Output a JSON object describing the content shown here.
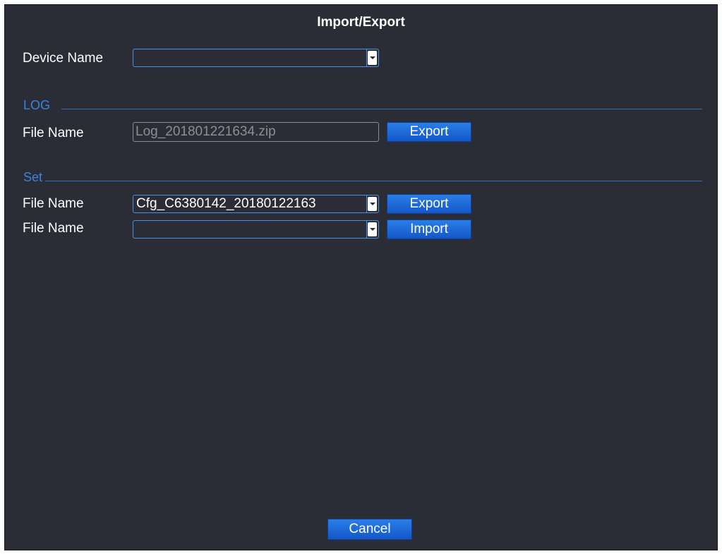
{
  "window": {
    "title": "Import/Export"
  },
  "device": {
    "label": "Device Name",
    "value": ""
  },
  "log_section": {
    "title": "LOG",
    "file_label": "File Name",
    "file_value": "Log_201801221634.zip",
    "export_label": "Export"
  },
  "set_section": {
    "title": "Set",
    "export_row": {
      "file_label": "File Name",
      "file_value": "Cfg_C6380142_20180122163",
      "button_label": "Export"
    },
    "import_row": {
      "file_label": "File Name",
      "file_value": "",
      "button_label": "Import"
    }
  },
  "footer": {
    "cancel_label": "Cancel"
  },
  "icons": {
    "dropdown": "chevron-down-icon"
  },
  "colors": {
    "background": "#2b2d36",
    "accent": "#4a90e2",
    "button": "#1e6de0",
    "section_title": "#3a84e0"
  }
}
